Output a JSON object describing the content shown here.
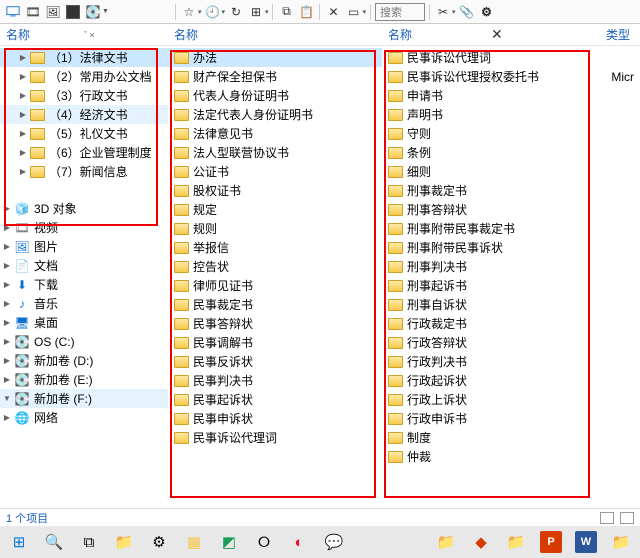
{
  "toolbar": {
    "search_placeholder": "搜索"
  },
  "headers": {
    "name": "名称",
    "type": "类型"
  },
  "status_text": "1 个项目",
  "meta_label": "Micr",
  "panel1": {
    "folders": [
      {
        "label": "（1）法律文书",
        "mode": "sel"
      },
      {
        "label": "（2）常用办公文档",
        "mode": ""
      },
      {
        "label": "（3）行政文书",
        "mode": ""
      },
      {
        "label": "（4）经济文书",
        "mode": "hl"
      },
      {
        "label": "（5）礼仪文书",
        "mode": ""
      },
      {
        "label": "（6）企业管理制度",
        "mode": ""
      },
      {
        "label": "（7）新闻信息",
        "mode": ""
      }
    ],
    "system": [
      {
        "icon": "🧊",
        "cls": "blue",
        "label": "3D 对象",
        "exp": "▶"
      },
      {
        "icon": "🎞",
        "cls": "grey",
        "label": "视频",
        "exp": "▶"
      },
      {
        "icon": "🖼",
        "cls": "blue",
        "label": "图片",
        "exp": "▶"
      },
      {
        "icon": "📄",
        "cls": "grey",
        "label": "文档",
        "exp": "▶"
      },
      {
        "icon": "⬇",
        "cls": "blue",
        "label": "下载",
        "exp": "▶"
      },
      {
        "icon": "♪",
        "cls": "blue",
        "label": "音乐",
        "exp": "▶"
      },
      {
        "icon": "🖥",
        "cls": "blue",
        "label": "桌面",
        "exp": "▶"
      },
      {
        "icon": "💽",
        "cls": "blue",
        "label": "OS (C:)",
        "exp": "▶"
      },
      {
        "icon": "💽",
        "cls": "grey",
        "label": "新加卷 (D:)",
        "exp": "▶"
      },
      {
        "icon": "💽",
        "cls": "grey",
        "label": "新加卷 (E:)",
        "exp": "▶"
      },
      {
        "icon": "💽",
        "cls": "grey",
        "label": "新加卷 (F:)",
        "exp": "▼",
        "sel": true
      },
      {
        "icon": "🌐",
        "cls": "blue",
        "label": "网络",
        "exp": "▶"
      }
    ]
  },
  "panel2": {
    "items": [
      {
        "label": "办法",
        "mode": "sel"
      },
      {
        "label": "财产保全担保书",
        "mode": ""
      },
      {
        "label": "代表人身份证明书",
        "mode": ""
      },
      {
        "label": "法定代表人身份证明书",
        "mode": ""
      },
      {
        "label": "法律意见书",
        "mode": ""
      },
      {
        "label": "法人型联营协议书",
        "mode": ""
      },
      {
        "label": "公证书",
        "mode": ""
      },
      {
        "label": "股权证书",
        "mode": ""
      },
      {
        "label": "规定",
        "mode": ""
      },
      {
        "label": "规则",
        "mode": ""
      },
      {
        "label": "举报信",
        "mode": ""
      },
      {
        "label": "控告状",
        "mode": ""
      },
      {
        "label": "律师见证书",
        "mode": ""
      },
      {
        "label": "民事裁定书",
        "mode": ""
      },
      {
        "label": "民事答辩状",
        "mode": ""
      },
      {
        "label": "民事调解书",
        "mode": ""
      },
      {
        "label": "民事反诉状",
        "mode": ""
      },
      {
        "label": "民事判决书",
        "mode": ""
      },
      {
        "label": "民事起诉状",
        "mode": ""
      },
      {
        "label": "民事申诉状",
        "mode": ""
      },
      {
        "label": "民事诉讼代理词",
        "mode": ""
      }
    ]
  },
  "panel3": {
    "items": [
      "民事诉讼代理词",
      "民事诉讼代理授权委托书",
      "申请书",
      "声明书",
      "守则",
      "条例",
      "细则",
      "刑事裁定书",
      "刑事答辩状",
      "刑事附带民事裁定书",
      "刑事附带民事诉状",
      "刑事判决书",
      "刑事起诉书",
      "刑事自诉状",
      "行政裁定书",
      "行政答辩状",
      "行政判决书",
      "行政起诉状",
      "行政上诉状",
      "行政申诉书",
      "制度",
      "仲裁"
    ]
  }
}
